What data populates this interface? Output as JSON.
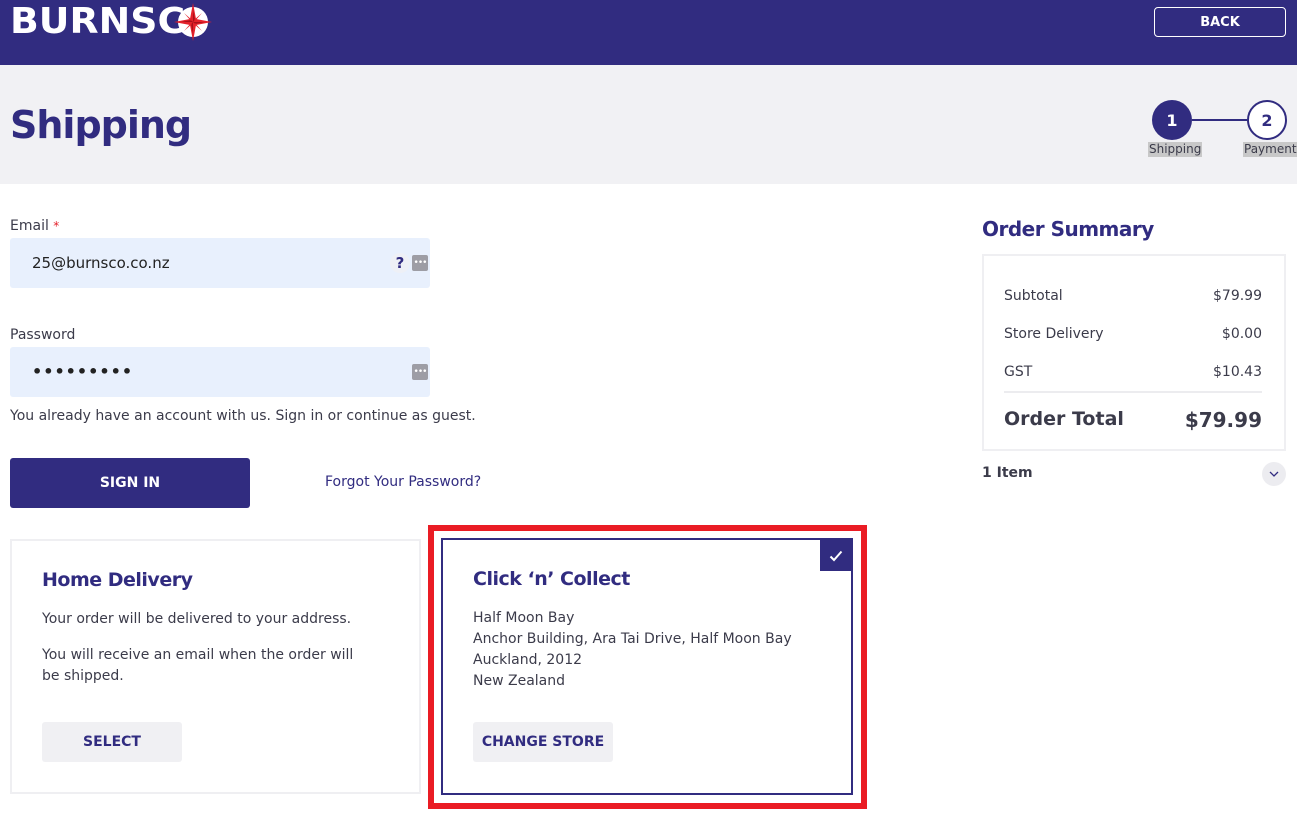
{
  "header": {
    "brand": "BURNSC",
    "brand_full": "BURNSCO",
    "back_label": "BACK",
    "colors": {
      "primary": "#312c80",
      "accent_red": "#e4202a",
      "band_bg": "#f1f1f4",
      "input_bg": "#e8f0fd"
    }
  },
  "page": {
    "title": "Shipping"
  },
  "stepper": {
    "steps": [
      {
        "number": "1",
        "label": "Shipping",
        "active": true
      },
      {
        "number": "2",
        "label": "Payment",
        "active": false
      }
    ]
  },
  "form": {
    "email": {
      "label": "Email",
      "required_marker": "*",
      "value": "25@burnsco.co.nz",
      "help_icon": "?",
      "autofill_icon": "•••"
    },
    "password": {
      "label": "Password",
      "value": "•••••••••",
      "autofill_icon": "•••"
    },
    "account_note": "You already have an account with us. Sign in or continue as guest.",
    "sign_in_label": "SIGN IN",
    "forgot_label": "Forgot Your Password?"
  },
  "delivery_options": {
    "home": {
      "title": "Home Delivery",
      "line1": "Your order will be delivered to your address.",
      "line2": "You will receive an email when the order will be shipped.",
      "button": "SELECT",
      "selected": false
    },
    "collect": {
      "title": "Click ‘n’ Collect",
      "address": [
        "Half Moon Bay",
        "Anchor Building, Ara Tai Drive, Half Moon Bay",
        "Auckland, 2012",
        "New Zealand"
      ],
      "button": "CHANGE STORE",
      "selected": true
    }
  },
  "summary": {
    "title": "Order Summary",
    "rows": [
      {
        "label": "Subtotal",
        "value": "$79.99"
      },
      {
        "label": "Store Delivery",
        "value": "$0.00"
      },
      {
        "label": "GST",
        "value": "$10.43"
      }
    ],
    "total_label": "Order Total",
    "total_value": "$79.99",
    "items_label": "1 Item"
  }
}
